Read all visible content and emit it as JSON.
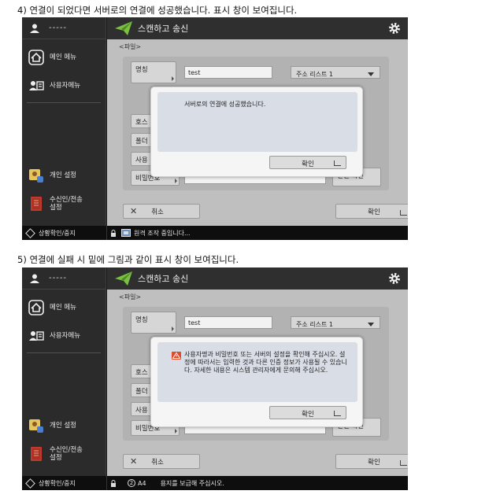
{
  "captions": {
    "step4": "4) 연결이 되었다면 서버로의 연결에 성공했습니다. 표시 창이 보여집니다.",
    "step5": "5) 연결에 실패 시 밑에 그림과 같이 표시 창이 보여집니다."
  },
  "screens": [
    {
      "user_name": "-----",
      "sidebar": {
        "main_menu": "메인 메뉴",
        "user_menu": "사용자메뉴",
        "personal_settings": "개인 설정",
        "recipient_settings_line1": "수신인/전송",
        "recipient_settings_line2": "설정"
      },
      "title": "스캔하고 송신",
      "file_label": "<파일>",
      "form": {
        "name_label": "명칭",
        "name_value": "test",
        "address_list": "주소 리스트 1",
        "host_label": "호스",
        "folder_label": "폴더",
        "user_label": "사용",
        "password_label": "비밀번호",
        "check_button": "확인",
        "connection_check": "연결 확인"
      },
      "cancel": "취소",
      "ok": "확인",
      "dialog": {
        "message": "서버로의 연결에 성공했습니다.",
        "ok": "확인",
        "warning": false
      },
      "status": {
        "button": "상황확인/중지",
        "text": "원격 조작 중입니다..."
      }
    },
    {
      "user_name": "-----",
      "sidebar": {
        "main_menu": "메인 메뉴",
        "user_menu": "사용자메뉴",
        "personal_settings": "개인 설정",
        "recipient_settings_line1": "수신인/전송",
        "recipient_settings_line2": "설정"
      },
      "title": "스캔하고 송신",
      "file_label": "<파일>",
      "form": {
        "name_label": "명칭",
        "name_value": "test",
        "address_list": "주소 리스트 1",
        "host_label": "호스",
        "folder_label": "폴더",
        "user_label": "사용",
        "password_label": "비밀번호",
        "check_button": "확인",
        "connection_check": "연결 확인"
      },
      "cancel": "취소",
      "ok": "확인",
      "dialog": {
        "message": "사용자명과 비밀번호 또는 서버의 설정을 확인해 주십시오. 설정에 따라서는 입력한 것과 다른 인증 정보가 사용될 수 있습니다. 자세한 내용은 시스템 관리자에게 문의해 주십시오.",
        "ok": "확인",
        "warning": true
      },
      "status": {
        "button": "상황확인/중지",
        "paper_size": "A4",
        "text": "용지를 보급해 주십시오."
      }
    }
  ],
  "colors": {
    "sidebar": "#2b2b2b",
    "main_bg": "#bfbfbf",
    "dialog_msg_bg": "#d9dde6",
    "plane_icon": "#7bc043",
    "warning_icon": "#e04a2a"
  }
}
